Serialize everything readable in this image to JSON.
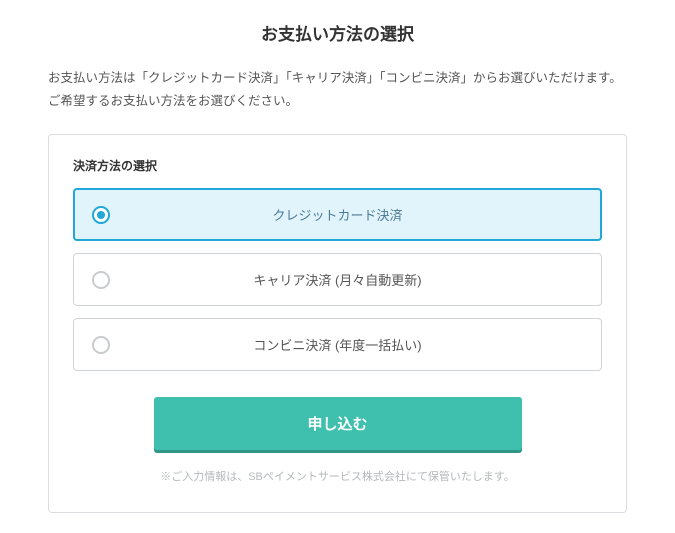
{
  "title": "お支払い方法の選択",
  "description": "お支払い方法は「クレジットカード決済」「キャリア決済」「コンビニ決済」からお選びいただけます。ご希望するお支払い方法をお選びください。",
  "section_label": "決済方法の選択",
  "options": [
    {
      "label": "クレジットカード決済",
      "selected": true
    },
    {
      "label": "キャリア決済 (月々自動更新)",
      "selected": false
    },
    {
      "label": "コンビニ決済 (年度一括払い)",
      "selected": false
    }
  ],
  "submit_label": "申し込む",
  "footnote": "※ご入力情報は、SBペイメントサービス株式会社にて保管いたします。"
}
